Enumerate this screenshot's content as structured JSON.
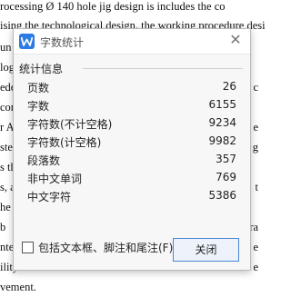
{
  "document": {
    "lines": [
      "rocessing  Ø   140 hole jig design is includes the co",
      "ising the technological design, the working procedure desi",
      "un",
      "log",
      "ede",
      "com",
      "r Af",
      "step",
      "s th",
      "s, a",
      "he f",
      "  b",
      "ntes",
      "ility",
      "vement."
    ],
    "right_fragments": [
      "b",
      "c",
      "e",
      "g",
      "t",
      "ra",
      "e",
      "e"
    ]
  },
  "dialog": {
    "title": "字数统计",
    "close_glyph": "✕",
    "section_label": "统计信息",
    "stats": [
      {
        "label": "页数",
        "value": "26"
      },
      {
        "label": "字数",
        "value": "6155"
      },
      {
        "label": "字符数(不计空格)",
        "value": "9234"
      },
      {
        "label": "字符数(计空格)",
        "value": "9982"
      },
      {
        "label": "段落数",
        "value": "357"
      },
      {
        "label": "非中文单词",
        "value": "769"
      },
      {
        "label": "中文字符",
        "value": "5386"
      }
    ],
    "checkbox_label": "包括文本框、脚注和尾注(F)",
    "checkbox_checked": false,
    "close_button": "关闭",
    "accent_color": "#2c7be5"
  }
}
